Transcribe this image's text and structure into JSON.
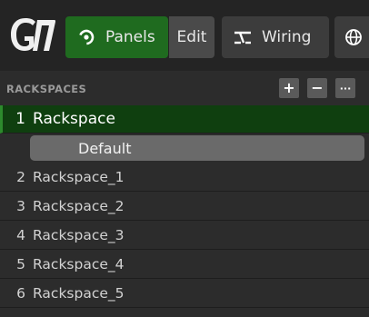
{
  "toolbar": {
    "logo_icon": "gp-logo-icon",
    "panels_label": "Panels",
    "panels_icon": "panels-icon",
    "edit_label": "Edit",
    "wiring_label": "Wiring",
    "wiring_icon": "wiring-icon",
    "globe_icon": "globe-icon",
    "accent_color": "#1f6b1f"
  },
  "rackspaces": {
    "header": "RACKSPACES",
    "add_label": "+",
    "remove_label": "−",
    "more_label": "···",
    "items": [
      {
        "num": "1",
        "name": "Rackspace",
        "active": true
      },
      {
        "num": "2",
        "name": "Rackspace_1",
        "active": false
      },
      {
        "num": "3",
        "name": "Rackspace_2",
        "active": false
      },
      {
        "num": "4",
        "name": "Rackspace_3",
        "active": false
      },
      {
        "num": "5",
        "name": "Rackspace_4",
        "active": false
      },
      {
        "num": "6",
        "name": "Rackspace_5",
        "active": false
      }
    ],
    "variation": "Default"
  }
}
